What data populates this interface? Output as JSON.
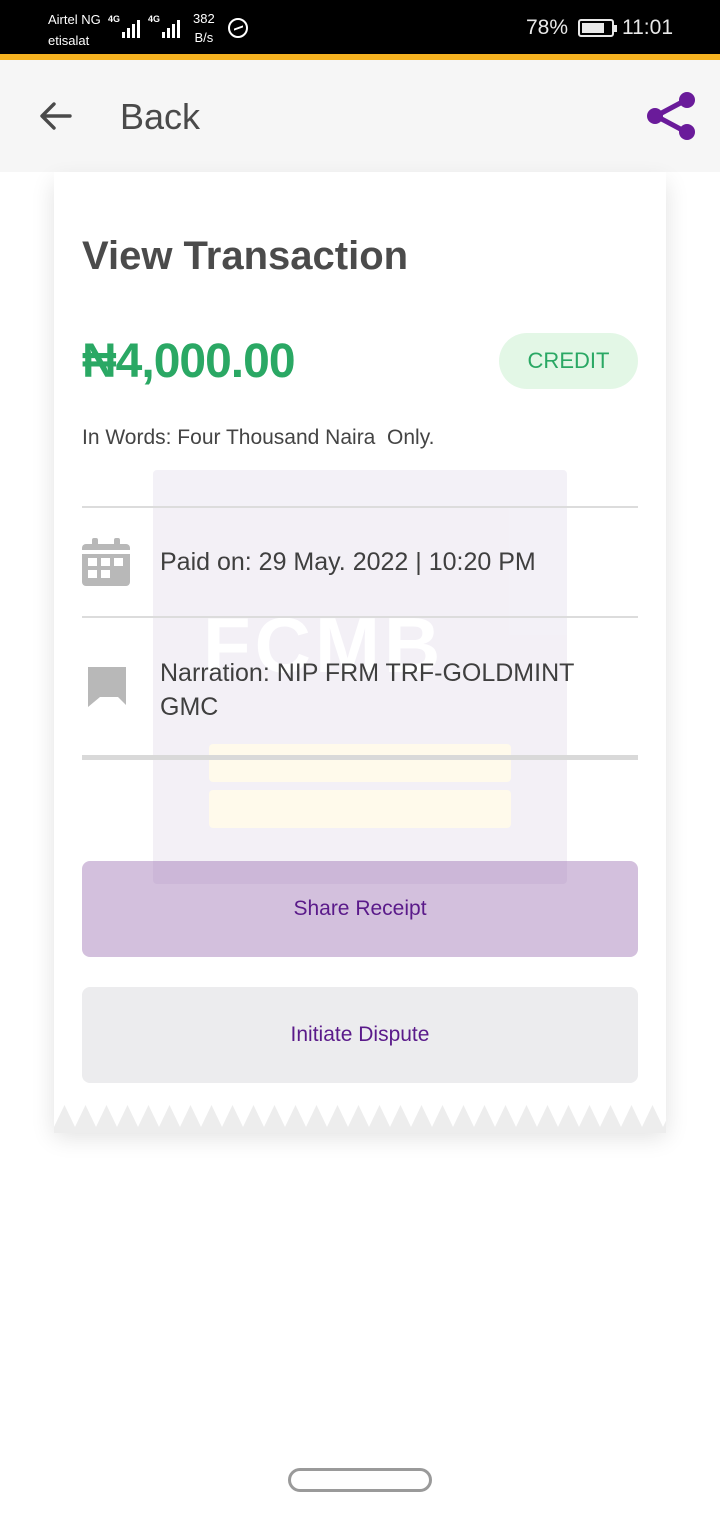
{
  "status_bar": {
    "carrier_1": "Airtel NG",
    "carrier_2": "etisalat",
    "network_1": "4G",
    "network_2": "4G",
    "speed_value": "382",
    "speed_unit": "B/s",
    "battery": "78%",
    "time": "11:01"
  },
  "app_bar": {
    "back_label": "Back",
    "back_icon": "arrow-left-icon",
    "share_icon": "share-icon"
  },
  "transaction": {
    "title": "View Transaction",
    "amount": "₦4,000.00",
    "type": "CREDIT",
    "in_words": "In Words: Four Thousand Naira  Only.",
    "paid_on": "Paid on: 29 May. 2022 | 10:20 PM",
    "narration": "Narration: NIP FRM TRF-GOLDMINT GMC",
    "watermark": "FCMB"
  },
  "actions": {
    "share_receipt": "Share Receipt",
    "initiate_dispute": "Initiate Dispute"
  },
  "colors": {
    "accent_green": "#2aa864",
    "brand_purple": "#6a1b9a",
    "status_accent": "#f5b220"
  }
}
